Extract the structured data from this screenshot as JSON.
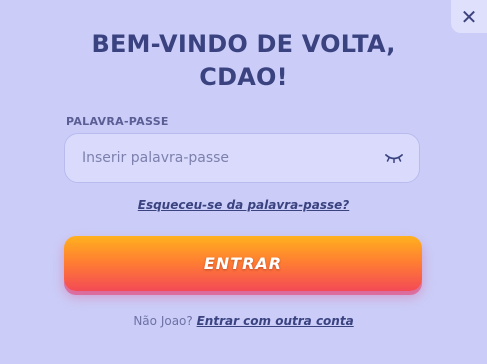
{
  "modal": {
    "close_icon": "close-icon",
    "close_glyph": "✕",
    "title_line1": "BEM-VINDO DE VOLTA,",
    "title_line2": "CDAO!",
    "password": {
      "label": "PALAVRA-PASSE",
      "value": "",
      "placeholder": "Inserir palavra-passe",
      "toggle_icon": "eye-closed-icon"
    },
    "forgot_link": "Esqueceu-se da palavra-passe?",
    "submit_label": "ENTRAR",
    "switch_prefix": "Não Joao?",
    "switch_link": "Entrar com outra conta"
  },
  "colors": {
    "background": "#cbcdf8",
    "title": "#3a4380",
    "button_top": "#ffb11e",
    "button_bottom": "#f34a56"
  }
}
